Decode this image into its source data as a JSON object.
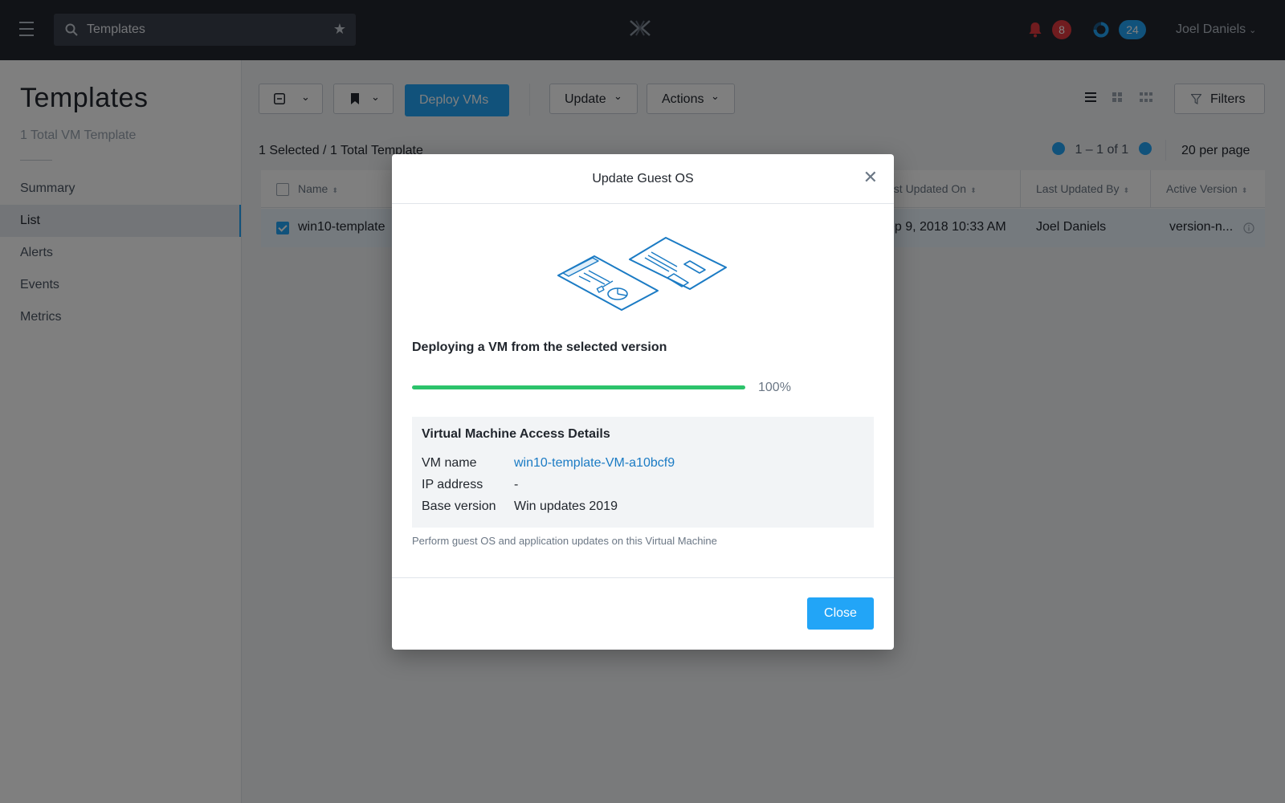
{
  "search": {
    "value": "Templates"
  },
  "notifications": {
    "alerts_count": "8",
    "tasks_count": "24"
  },
  "user": {
    "name": "Joel Daniels"
  },
  "sidebar": {
    "title": "Templates",
    "subtitle": "1 Total VM Template",
    "items": [
      {
        "label": "Summary"
      },
      {
        "label": "List",
        "active": true
      },
      {
        "label": "Alerts"
      },
      {
        "label": "Events"
      },
      {
        "label": "Metrics"
      }
    ]
  },
  "toolbar": {
    "deploy_label": "Deploy VMs",
    "update_label": "Update",
    "actions_label": "Actions",
    "filters_label": "Filters"
  },
  "selection": {
    "info": "1 Selected / 1 Total Template"
  },
  "pagination": {
    "range": "1 – 1 of 1",
    "per_page": "20 per page"
  },
  "table": {
    "columns": [
      "Name",
      "ast Updated On",
      "Last Updated By",
      "Active Version"
    ],
    "rows": [
      {
        "name": "win10-template",
        "updated_on": "ep 9, 2018 10:33 AM",
        "updated_by": "Joel Daniels",
        "version": "version-n..."
      }
    ]
  },
  "modal": {
    "title": "Update Guest OS",
    "status": "Deploying a VM from the selected version",
    "progress": 100,
    "progress_label": "100%",
    "details_title": "Virtual Machine Access Details",
    "details": [
      {
        "key": "VM name",
        "value": "win10-template-VM-a10bcf9"
      },
      {
        "key": "IP address",
        "value": "-"
      },
      {
        "key": "Base version",
        "value": "Win updates 2019"
      }
    ],
    "help_text": "Perform guest OS and application updates on this Virtual Machine",
    "close_label": "Close"
  },
  "colors": {
    "accent": "#22a5f7",
    "progress": "#2cc36b",
    "alert_badge": "#e0383e",
    "topnav": "#22272e",
    "link": "#1b7bc4"
  },
  "icons": [
    "hamburger-icon",
    "search-icon",
    "star-icon",
    "logo-icon",
    "bell-icon",
    "tasks-ring-icon",
    "chevron-down-icon",
    "bookmark-icon",
    "list-view-icon",
    "grid-view-icon",
    "compact-view-icon",
    "filter-icon",
    "chevron-left-icon",
    "chevron-right-icon",
    "info-icon",
    "close-icon"
  ]
}
